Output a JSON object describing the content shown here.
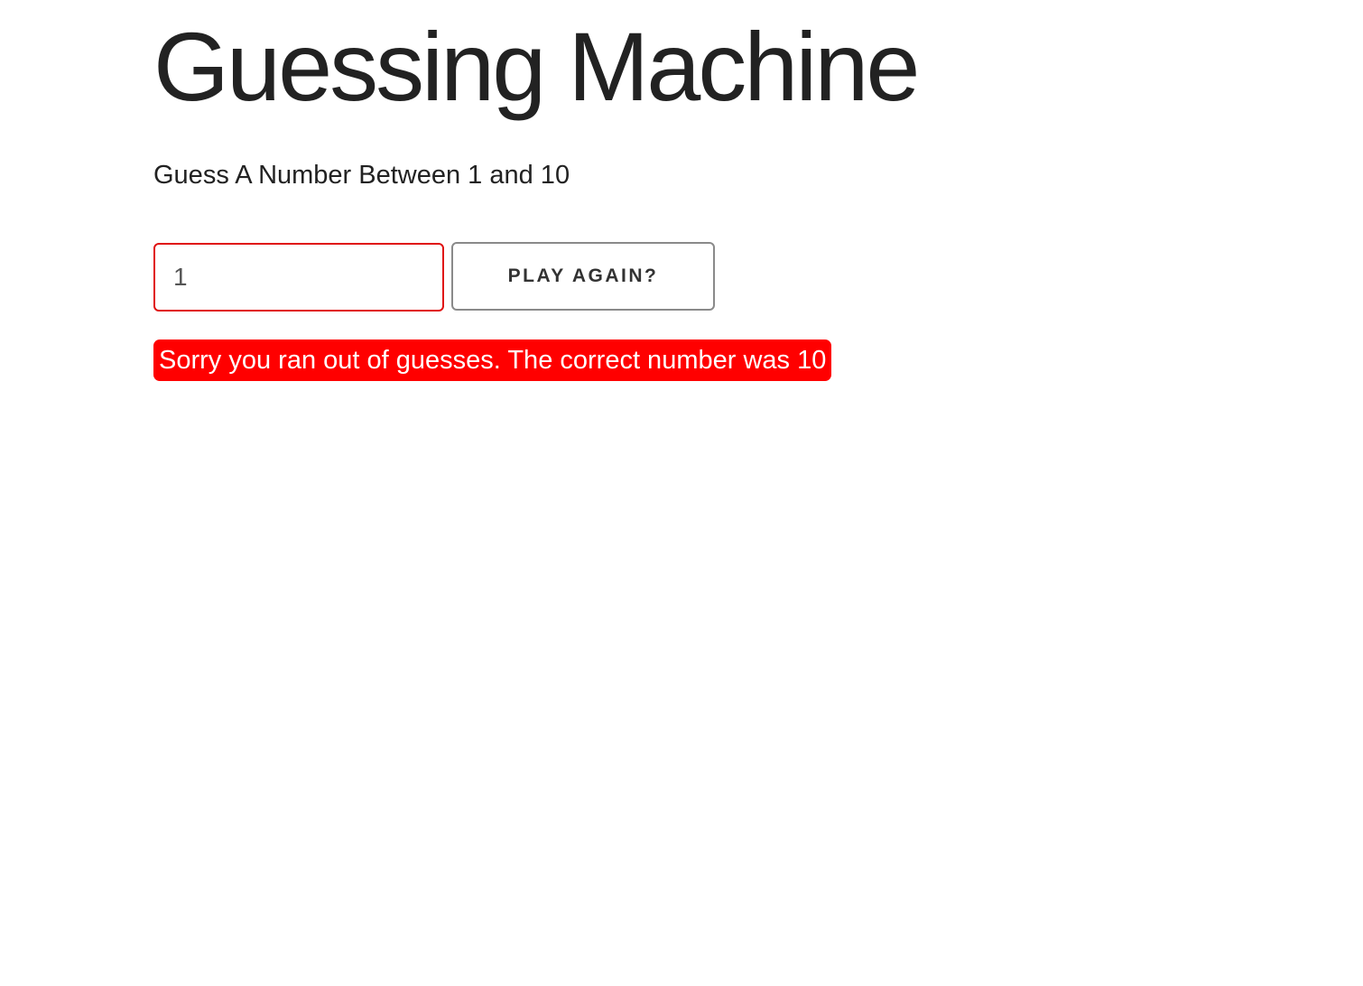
{
  "app": {
    "title": "Guessing Machine",
    "instruction": "Guess A Number Between 1 and 10"
  },
  "form": {
    "guess_value": "1",
    "play_again_label": "PLAY AGAIN?"
  },
  "status": {
    "message": "Sorry you ran out of guesses. The correct number was 10",
    "message_background": "#ff0000",
    "input_border_color": "#e01010"
  }
}
